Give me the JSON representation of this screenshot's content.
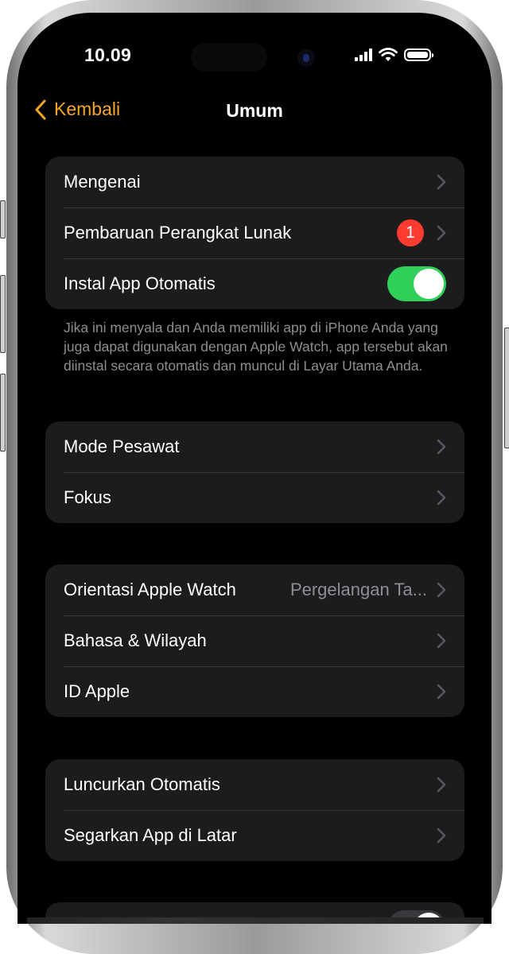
{
  "status_bar": {
    "time": "10.09",
    "icons": [
      "cellular-signal-icon",
      "wifi-icon",
      "battery-icon"
    ]
  },
  "nav": {
    "back_label": "Kembali",
    "back_icon": "chevron-left-icon",
    "title": "Umum"
  },
  "colors": {
    "accent": "#f5a623",
    "toggle_on": "#30d158",
    "badge": "#ff3b30",
    "cell_bg": "#1c1c1e"
  },
  "groups": [
    {
      "rows": [
        {
          "label": "Mengenai",
          "accessory": "chevron"
        },
        {
          "label": "Pembaruan Perangkat Lunak",
          "badge": "1",
          "accessory": "chevron"
        },
        {
          "label": "Instal App Otomatis",
          "accessory": "toggle",
          "toggle_on": true
        }
      ],
      "footnote": "Jika ini menyala dan Anda memiliki app di iPhone Anda yang juga dapat digunakan dengan Apple Watch, app tersebut akan diinstal secara otomatis dan muncul di Layar Utama Anda."
    },
    {
      "rows": [
        {
          "label": "Mode Pesawat",
          "accessory": "chevron"
        },
        {
          "label": "Fokus",
          "accessory": "chevron"
        }
      ]
    },
    {
      "rows": [
        {
          "label": "Orientasi Apple Watch",
          "value": "Pergelangan Ta...",
          "accessory": "chevron"
        },
        {
          "label": "Bahasa & Wilayah",
          "accessory": "chevron"
        },
        {
          "label": "ID Apple",
          "accessory": "chevron"
        }
      ]
    },
    {
      "rows": [
        {
          "label": "Luncurkan Otomatis",
          "accessory": "chevron"
        },
        {
          "label": "Segarkan App di Latar",
          "accessory": "chevron"
        }
      ]
    },
    {
      "rows": [
        {
          "label": "",
          "accessory": "toggle",
          "toggle_on": false
        }
      ]
    }
  ]
}
